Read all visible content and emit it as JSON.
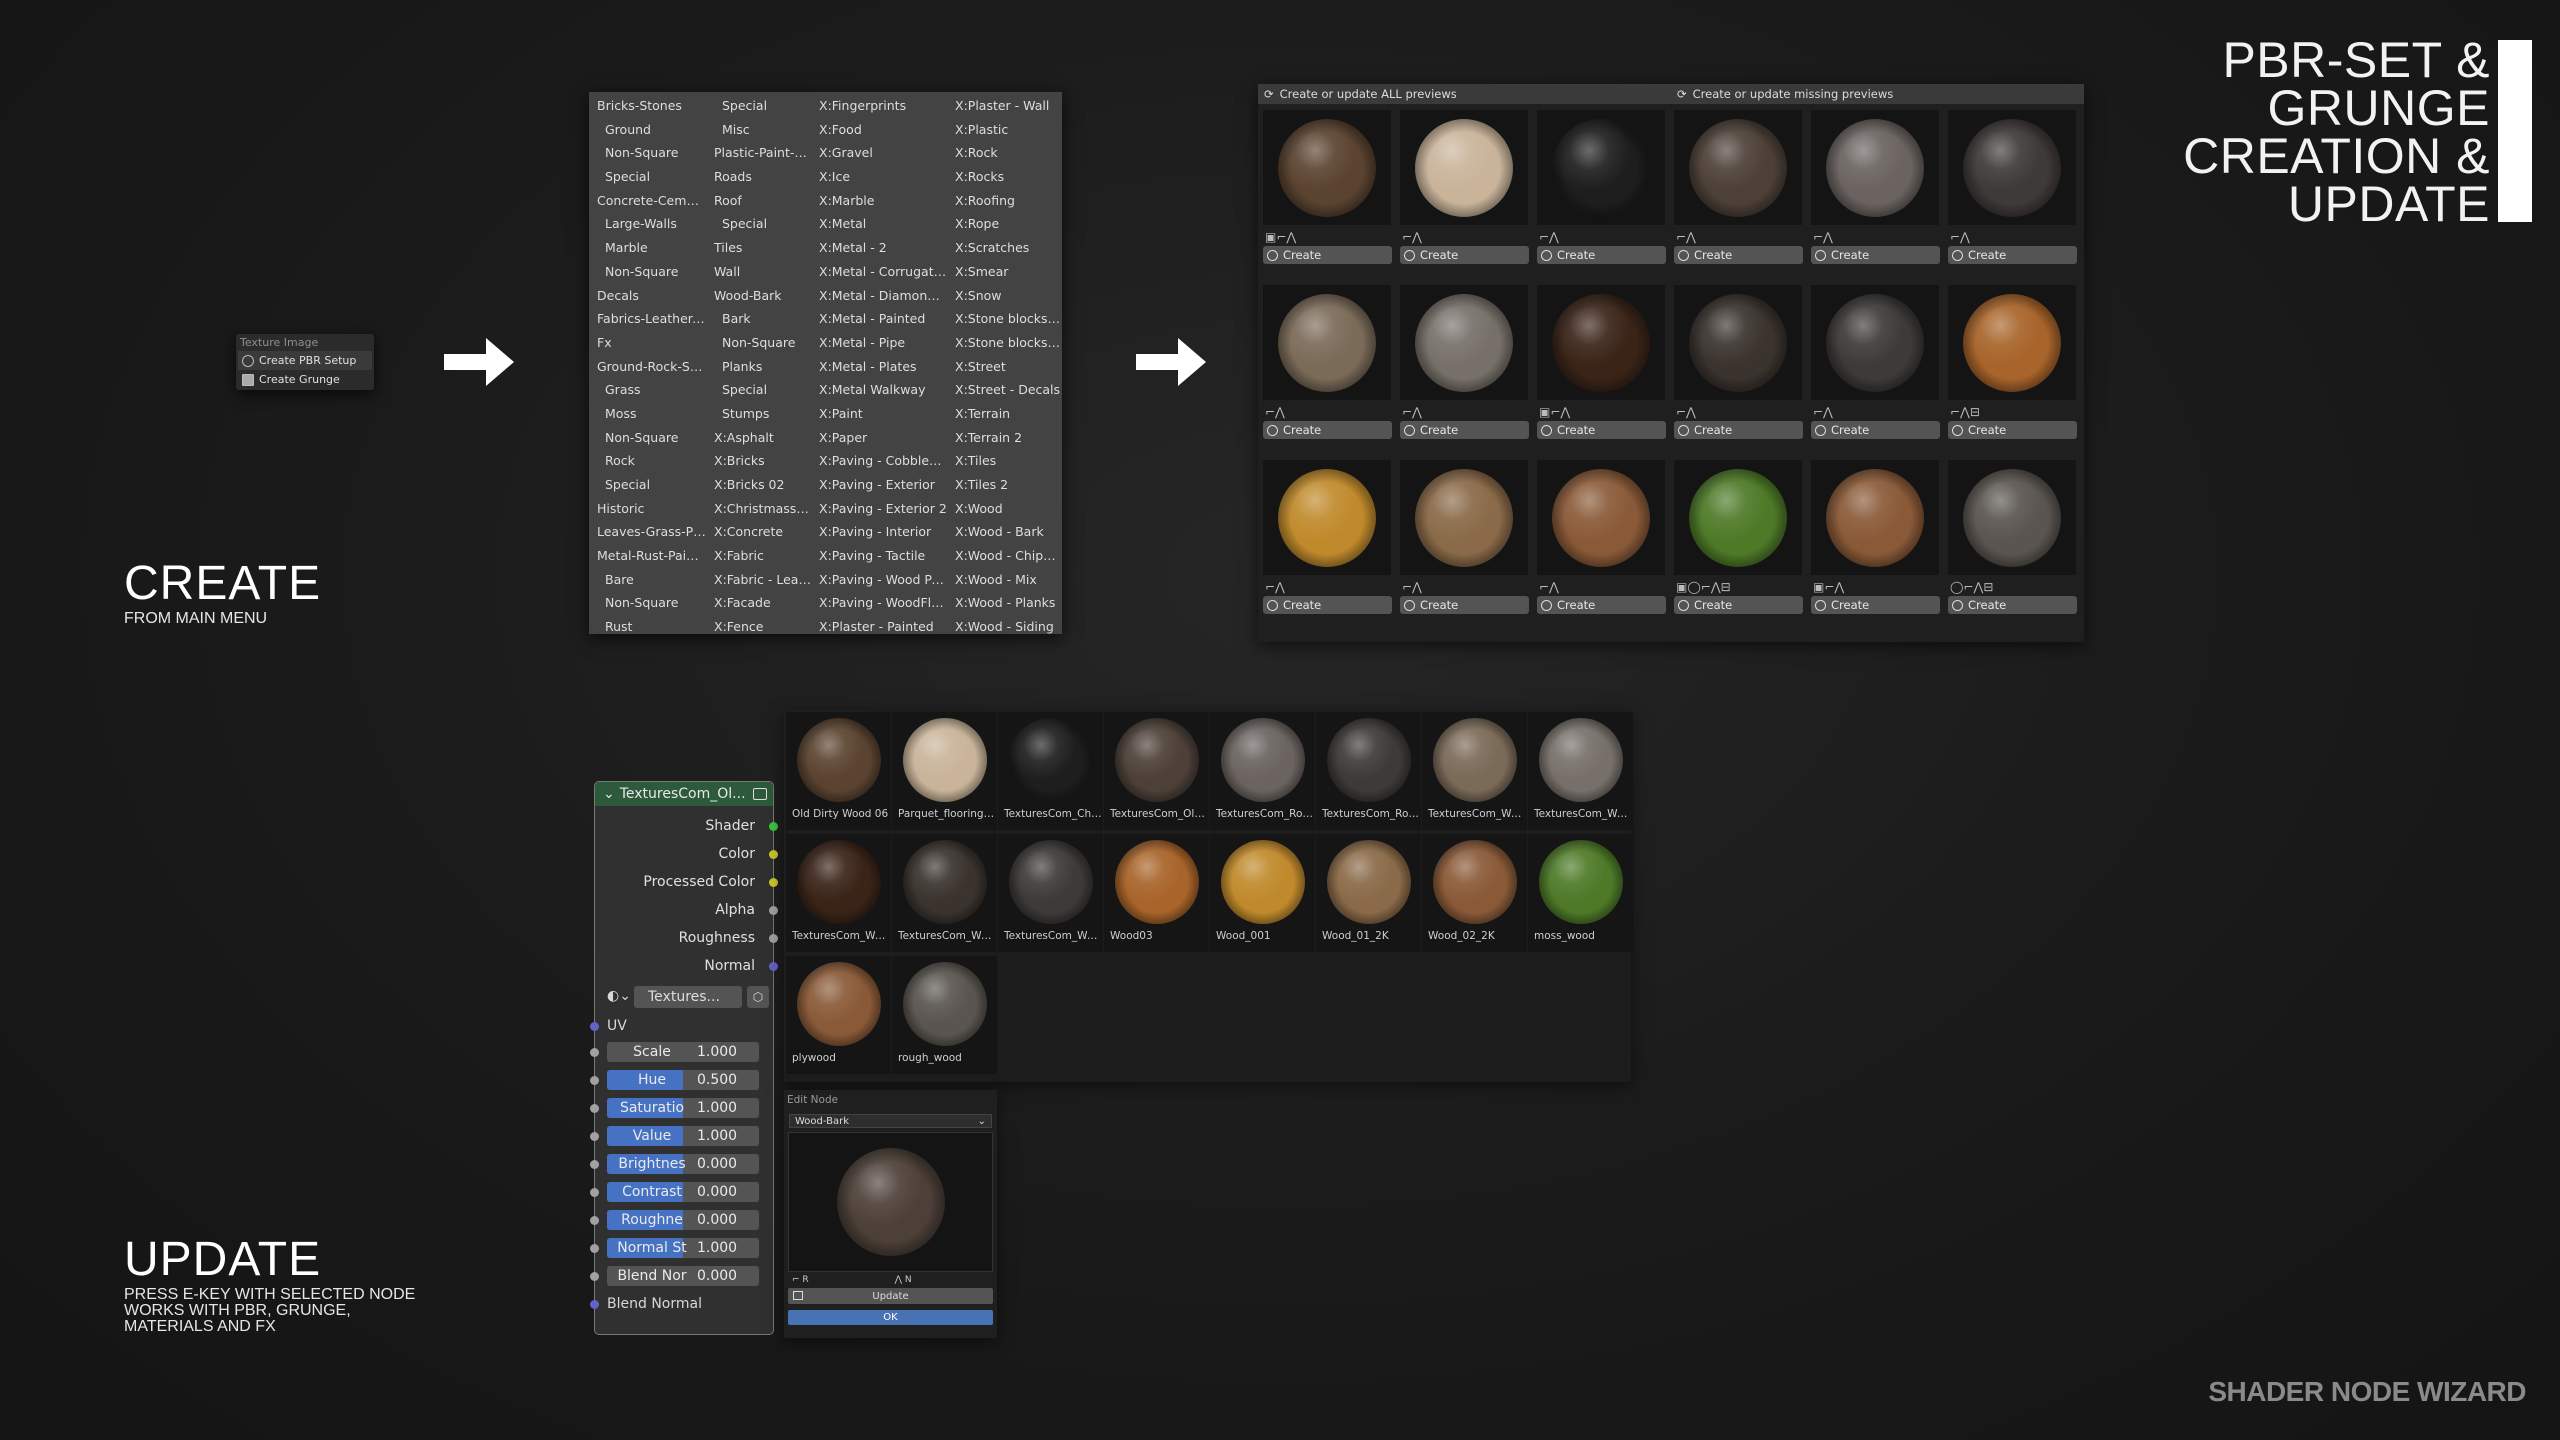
{
  "title": {
    "lines": [
      "PBR-SET &",
      "GRUNGE",
      "CREATION &",
      "UPDATE"
    ]
  },
  "create_section": {
    "heading": "CREATE",
    "subheading": "FROM MAIN MENU"
  },
  "update_section": {
    "heading": "UPDATE",
    "subheading_lines": [
      "PRESS E-KEY WITH SELECTED NODE",
      "WORKS WITH PBR, GRUNGE,",
      "MATERIALS AND FX"
    ]
  },
  "brand": "SHADER NODE WIZARD",
  "context_menu": {
    "header": "Texture Image",
    "items": [
      {
        "label": "Create PBR Setup",
        "icon": "material-icon"
      },
      {
        "label": "Create Grunge",
        "icon": "image-icon"
      }
    ]
  },
  "library_menu": {
    "columns": [
      [
        "Bricks-Stones",
        "Ground",
        "Non-Square",
        "Special",
        "Concrete-Cemen...",
        "Large-Walls",
        "Marble",
        "Non-Square",
        "Decals",
        "Fabrics-Leather-...",
        "Fx",
        "Ground-Rock-Sto...",
        "Grass",
        "Moss",
        "Non-Square",
        "Rock",
        "Special",
        "Historic",
        "Leaves-Grass-Pla...",
        "Metal-Rust-Paint...",
        "Bare",
        "Non-Square",
        "Rust"
      ],
      [
        "Special",
        "Misc",
        "Plastic-Paint-R...",
        "Roads",
        "Roof",
        "Special",
        "Tiles",
        "Wall",
        "Wood-Bark",
        "Bark",
        "Non-Square",
        "Planks",
        "Special",
        "Stumps",
        "X:Asphalt",
        "X:Bricks",
        "X:Bricks 02",
        "X:Christmass ...",
        "X:Concrete",
        "X:Fabric",
        "X:Fabric - Leat...",
        "X:Facade",
        "X:Fence"
      ],
      [
        "X:Fingerprints",
        "X:Food",
        "X:Gravel",
        "X:Ice",
        "X:Marble",
        "X:Metal",
        "X:Metal - 2",
        "X:Metal - Corrugated",
        "X:Metal - Diamond ...",
        "X:Metal - Painted",
        "X:Metal - Pipe",
        "X:Metal - Plates",
        "X:Metal Walkway",
        "X:Paint",
        "X:Paper",
        "X:Paving - Cobblest...",
        "X:Paving - Exterior",
        "X:Paving - Exterior 2",
        "X:Paving - Interior",
        "X:Paving - Tactile",
        "X:Paving - Wood Par...",
        "X:Paving - WoodFloor",
        "X:Plaster - Painted"
      ],
      [
        "X:Plaster - Wall",
        "X:Plastic",
        "X:Rock",
        "X:Rocks",
        "X:Roofing",
        "X:Rope",
        "X:Scratches",
        "X:Smear",
        "X:Snow",
        "X:Stone blocks - ...",
        "X:Stone blocks - ...",
        "X:Street",
        "X:Street - Decals",
        "X:Terrain",
        "X:Terrain 2",
        "X:Tiles",
        "X:Tiles 2",
        "X:Wood",
        "X:Wood - Bark",
        "X:Wood - Chipbo...",
        "X:Wood - Mix",
        "X:Wood - Planks",
        "X:Wood - Siding"
      ]
    ],
    "indented": [
      [
        1,
        2,
        3,
        5,
        6,
        7,
        12,
        13,
        14,
        15,
        16,
        20,
        21,
        22
      ],
      [
        0,
        1,
        5,
        9,
        10,
        11,
        12,
        13
      ],
      [],
      []
    ]
  },
  "preview_grid": {
    "update_all_label": "Create or update ALL previews",
    "update_missing_label": "Create or update missing previews",
    "button_label": "Create",
    "cells": [
      {
        "icons": "▣⌐⋀",
        "color": "#5a4330"
      },
      {
        "icons": "⌐⋀",
        "color": "#c9b49a"
      },
      {
        "icons": "⌐⋀",
        "color": "#1e1e1e"
      },
      {
        "icons": "⌐⋀",
        "color": "#4d4038"
      },
      {
        "icons": "⌐⋀",
        "color": "#6a6360"
      },
      {
        "icons": "⌐⋀",
        "color": "#3e3a38"
      },
      {
        "icons": "⌐⋀",
        "color": "#7a6a58"
      },
      {
        "icons": "⌐⋀",
        "color": "#77706a"
      },
      {
        "icons": "▣⌐⋀",
        "color": "#3a2418"
      },
      {
        "icons": "⌐⋀",
        "color": "#3a332e"
      },
      {
        "icons": "⌐⋀",
        "color": "#3d3a38"
      },
      {
        "icons": "⌐⋀⊟",
        "color": "#a8642a"
      },
      {
        "icons": "⌐⋀",
        "color": "#c08a2c"
      },
      {
        "icons": "⌐⋀",
        "color": "#8a6a48"
      },
      {
        "icons": "⌐⋀",
        "color": "#8a5a38"
      },
      {
        "icons": "▣◯⌐⋀⊟",
        "color": "#4e7a28"
      },
      {
        "icons": "▣⌐⋀",
        "color": "#8a5a38"
      },
      {
        "icons": "◯⌐⋀⊟",
        "color": "#5a5550"
      }
    ]
  },
  "node": {
    "title": "TexturesCom_Ol...",
    "outputs": [
      {
        "label": "Shader",
        "color": "#3ec43e"
      },
      {
        "label": "Color",
        "color": "#c7c729"
      },
      {
        "label": "Processed Color",
        "color": "#c7c729"
      },
      {
        "label": "Alpha",
        "color": "#a1a1a1"
      },
      {
        "label": "Roughness",
        "color": "#a1a1a1"
      },
      {
        "label": "Normal",
        "color": "#6363c7"
      }
    ],
    "selector_label": "Textures...",
    "uv_label": "UV",
    "inputs": [
      {
        "label": "Scale",
        "value": "1.000",
        "fill": 0
      },
      {
        "label": "Hue",
        "value": "0.500",
        "fill": 0.5
      },
      {
        "label": "Saturatio",
        "value": "1.000",
        "fill": 0.5
      },
      {
        "label": "Value",
        "value": "1.000",
        "fill": 0.5
      },
      {
        "label": "Brightnes",
        "value": "0.000",
        "fill": 0.5
      },
      {
        "label": "Contrast",
        "value": "0.000",
        "fill": 0.5
      },
      {
        "label": "Roughne",
        "value": "0.000",
        "fill": 0.5
      },
      {
        "label": "Normal St",
        "value": "1.000",
        "fill": 0.5
      },
      {
        "label": "Blend Nor",
        "value": "0.000",
        "fill": 0
      }
    ],
    "blend_normal_label": "Blend Normal"
  },
  "browser": {
    "items": [
      {
        "name": "Old Dirty Wood 06",
        "color": "#5a4330"
      },
      {
        "name": "Parquet_flooring_0...",
        "color": "#c9b49a"
      },
      {
        "name": "TexturesCom_Cha...",
        "color": "#1e1e1e"
      },
      {
        "name": "TexturesCom_Old...",
        "color": "#4d4038"
      },
      {
        "name": "TexturesCom_Rou...",
        "color": "#6a6360"
      },
      {
        "name": "TexturesCom_Rou...",
        "color": "#3e3a38"
      },
      {
        "name": "TexturesCom_Woo...",
        "color": "#7a6a58"
      },
      {
        "name": "TexturesCom_Woo...",
        "color": "#77706a"
      },
      {
        "name": "TexturesCom_Woo...",
        "color": "#3a2418"
      },
      {
        "name": "TexturesCom_Woo...",
        "color": "#3a332e"
      },
      {
        "name": "TexturesCom_Woo...",
        "color": "#3d3a38"
      },
      {
        "name": "Wood03",
        "color": "#a8642a"
      },
      {
        "name": "Wood_001",
        "color": "#c08a2c"
      },
      {
        "name": "Wood_01_2K",
        "color": "#8a6a48"
      },
      {
        "name": "Wood_02_2K",
        "color": "#8a5a38"
      },
      {
        "name": "moss_wood",
        "color": "#4e7a28"
      },
      {
        "name": "plywood",
        "color": "#8a5a38"
      },
      {
        "name": "rough_wood",
        "color": "#5a5550"
      }
    ]
  },
  "edit_node": {
    "header": "Edit Node",
    "dropdown_value": "Wood-Bark",
    "preview_color": "#4d4038",
    "icon_r": "R",
    "icon_n": "N",
    "update_label": "Update",
    "ok_label": "OK"
  }
}
